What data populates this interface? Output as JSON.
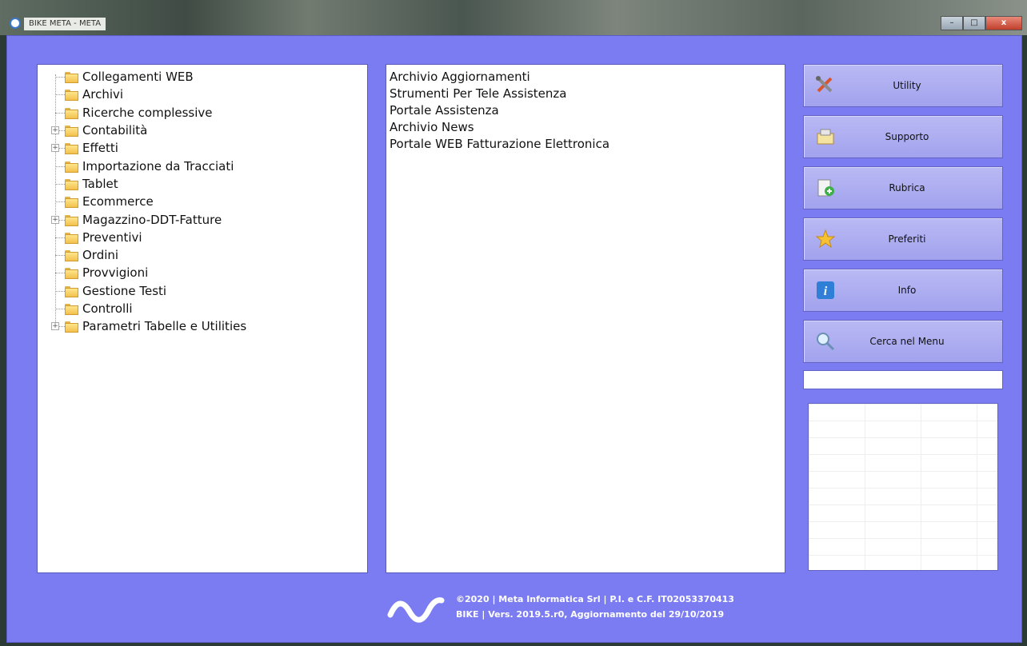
{
  "window": {
    "title": "BIKE META - META",
    "controls": {
      "minimize": "–",
      "maximize": "□",
      "close": "x"
    }
  },
  "tree": {
    "items": [
      {
        "label": "Collegamenti WEB",
        "expandable": false
      },
      {
        "label": "Archivi",
        "expandable": false
      },
      {
        "label": "Ricerche complessive",
        "expandable": false
      },
      {
        "label": "Contabilità",
        "expandable": true
      },
      {
        "label": "Effetti",
        "expandable": true
      },
      {
        "label": "Importazione da Tracciati",
        "expandable": false
      },
      {
        "label": "Tablet",
        "expandable": false
      },
      {
        "label": "Ecommerce",
        "expandable": false
      },
      {
        "label": "Magazzino-DDT-Fatture",
        "expandable": true
      },
      {
        "label": "Preventivi",
        "expandable": false
      },
      {
        "label": "Ordini",
        "expandable": false
      },
      {
        "label": "Provvigioni",
        "expandable": false
      },
      {
        "label": "Gestione Testi",
        "expandable": false
      },
      {
        "label": "Controlli",
        "expandable": false
      },
      {
        "label": "Parametri Tabelle e Utilities",
        "expandable": true
      }
    ]
  },
  "list": {
    "items": [
      "Archivio Aggiornamenti",
      "Strumenti Per Tele Assistenza",
      "Portale Assistenza",
      "Archivio News",
      "Portale WEB Fatturazione Elettronica"
    ]
  },
  "sidebar": {
    "buttons": [
      {
        "label": "Utility",
        "icon": "tools-icon"
      },
      {
        "label": "Supporto",
        "icon": "support-icon"
      },
      {
        "label": "Rubrica",
        "icon": "address-book-icon"
      },
      {
        "label": "Preferiti",
        "icon": "star-icon"
      },
      {
        "label": "Info",
        "icon": "info-icon"
      },
      {
        "label": "Cerca nel Menu",
        "icon": "magnifier-icon"
      }
    ],
    "search": {
      "value": ""
    }
  },
  "footer": {
    "line1": "©2020 | Meta Informatica Srl | P.I. e C.F. IT02053370413",
    "line2": "BIKE | Vers. 2019.5.r0, Aggiornamento del 29/10/2019"
  },
  "colors": {
    "background": "#7b7cf2",
    "button": "#a2a2ee",
    "folder": "#f2c14e"
  }
}
